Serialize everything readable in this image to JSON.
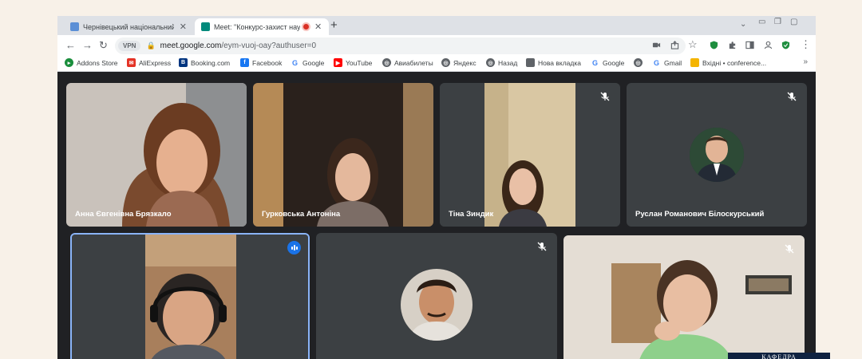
{
  "tabs": [
    {
      "title": "Чернівецький національний ун",
      "active": false
    },
    {
      "title": "Meet: \"Конкурс-захист наук",
      "active": true
    }
  ],
  "toolbar": {
    "vpn_label": "VPN",
    "url_host": "meet.google.com",
    "url_path": "/eym-vuoj-oay?authuser=0"
  },
  "bookmarks": [
    {
      "label": "Addons Store",
      "icon": "addons-icon",
      "color": "#1a8e3c"
    },
    {
      "label": "AliExpress",
      "icon": "aliexpress-icon",
      "color": "#e43225"
    },
    {
      "label": "Booking.com",
      "icon": "booking-icon",
      "color": "#003580"
    },
    {
      "label": "Facebook",
      "icon": "facebook-icon",
      "color": "#1877f2"
    },
    {
      "label": "Google",
      "icon": "google-icon",
      "color": "#4285f4"
    },
    {
      "label": "YouTube",
      "icon": "youtube-icon",
      "color": "#ff0000"
    },
    {
      "label": "Авиабилеты",
      "icon": "globe-icon",
      "color": "#5f6368"
    },
    {
      "label": "Яндекс",
      "icon": "globe-icon",
      "color": "#5f6368"
    },
    {
      "label": "Назад",
      "icon": "globe-icon",
      "color": "#5f6368"
    },
    {
      "label": "Нова вкладка",
      "icon": "page-icon",
      "color": "#5f6368"
    },
    {
      "label": "Google",
      "icon": "google-icon",
      "color": "#4285f4"
    },
    {
      "label": "",
      "icon": "globe-icon",
      "color": "#5f6368"
    },
    {
      "label": "Gmail",
      "icon": "google-icon",
      "color": "#4285f4"
    },
    {
      "label": "Вхідні • conference...",
      "icon": "folder-icon",
      "color": "#f4b400"
    }
  ],
  "participants": [
    {
      "name": "Анна Євгенівна Брязкало",
      "muted": false,
      "speaking": false,
      "video": true
    },
    {
      "name": "Гурковська Антоніна",
      "muted": false,
      "speaking": false,
      "video": true
    },
    {
      "name": "Тіна Зиндик",
      "muted": true,
      "speaking": false,
      "video": true
    },
    {
      "name": "Руслан Романович Білоскурський",
      "muted": true,
      "speaking": false,
      "video": false
    },
    {
      "name": "",
      "muted": false,
      "speaking": true,
      "video": true
    },
    {
      "name": "",
      "muted": true,
      "speaking": false,
      "video": false
    },
    {
      "name": "",
      "muted": true,
      "speaking": false,
      "video": true
    }
  ],
  "overlay": {
    "label": "КАФЕДРА"
  },
  "colors": {
    "meet_bg": "#202124",
    "tile_bg": "#3c4043",
    "speaking_border": "#8ab4f8",
    "accent": "#1a73e8"
  }
}
